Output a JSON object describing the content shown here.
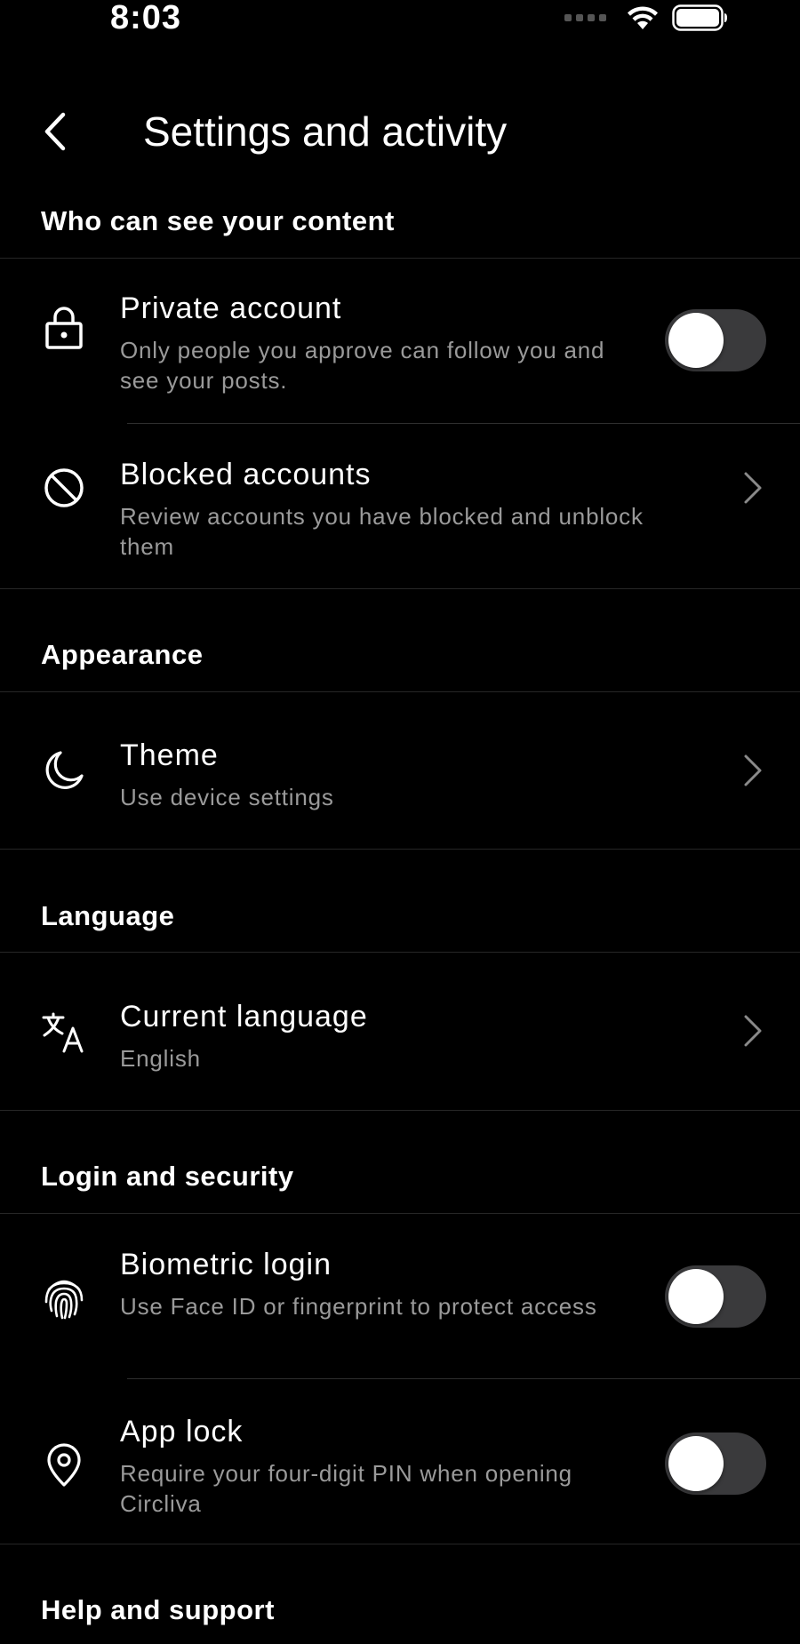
{
  "status_bar": {
    "time": "8:03",
    "icons": [
      "signal-icon",
      "wifi-icon",
      "battery-icon"
    ]
  },
  "header": {
    "back_icon": "chevron-left-icon",
    "title": "Settings and activity"
  },
  "sections": {
    "content": {
      "header": "Who can see your content",
      "private_account": {
        "icon": "lock-icon",
        "title": "Private account",
        "desc": "Only people you approve can follow you and see your posts.",
        "toggle_on": false
      },
      "blocked_accounts": {
        "icon": "blocked-icon",
        "title": "Blocked accounts",
        "desc": "Review accounts you have blocked and unblock them"
      }
    },
    "appearance": {
      "header": "Appearance",
      "theme": {
        "icon": "moon-icon",
        "title": "Theme",
        "desc": "Use device settings"
      }
    },
    "language": {
      "header": "Language",
      "current_language": {
        "icon": "translate-icon",
        "title": "Current language",
        "desc": "English"
      }
    },
    "security": {
      "header": "Login and security",
      "biometric_login": {
        "icon": "fingerprint-icon",
        "title": "Biometric login",
        "desc": "Use Face ID or fingerprint to protect access",
        "toggle_on": false
      },
      "app_lock": {
        "icon": "location-pin-icon",
        "title": "App lock",
        "desc": "Require your four-digit PIN when opening Circliva",
        "toggle_on": false
      }
    },
    "help": {
      "header": "Help and support"
    }
  },
  "colors": {
    "background": "#000000",
    "text_primary": "#ffffff",
    "text_secondary": "#9a9a9a",
    "divider": "#262626",
    "toggle_off": "#3a3a3c"
  }
}
